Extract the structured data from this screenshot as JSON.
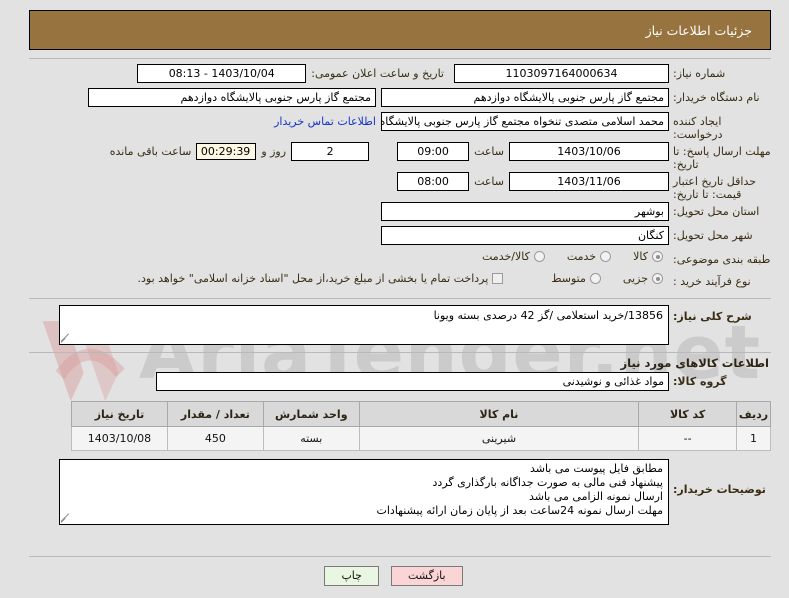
{
  "header": {
    "title": "جزئیات اطلاعات نیاز"
  },
  "form": {
    "need_number_label": "شماره نیاز:",
    "need_number_value": "1103097164000634",
    "announce_datetime_label": "تاریخ و ساعت اعلان عمومی:",
    "announce_datetime_value": "1403/10/04 - 08:13",
    "buyer_org_label": "نام دستگاه خریدار:",
    "buyer_org_value": "مجتمع گاز پارس جنوبی  پالایشگاه دوازدهم",
    "buyer_org_value2": "مجتمع گاز پارس جنوبی  پالایشگاه دوازدهم",
    "creator_label": "ایجاد کننده درخواست:",
    "creator_value": "محمد اسلامی متصدی تنخواه مجتمع گاز پارس جنوبی  پالایشگاه دوازدهم",
    "contact_link": "اطلاعات تماس خریدار",
    "deadline_label": "مهلت ارسال پاسخ: تا تاریخ:",
    "deadline_date": "1403/10/06",
    "deadline_hour_label": "ساعت",
    "deadline_time": "09:00",
    "days_value": "2",
    "days_label": "روز و",
    "countdown_value": "00:29:39",
    "countdown_label": "ساعت باقی مانده",
    "price_validity_label": "حداقل تاریخ اعتبار قیمت: تا تاریخ:",
    "price_validity_date": "1403/11/06",
    "price_validity_hour_label": "ساعت",
    "price_validity_time": "08:00",
    "province_label": "استان محل تحویل:",
    "province_value": "بوشهر",
    "city_label": "شهر محل تحویل:",
    "city_value": "کنگان",
    "category_label": "طبقه بندی موضوعی:",
    "category_options": [
      "کالا",
      "خدمت",
      "کالا/خدمت"
    ],
    "category_selected_index": 0,
    "process_label": "نوع فرآیند خرید :",
    "process_options": [
      "جزیی",
      "متوسط"
    ],
    "process_selected_index": 0,
    "treasury_checkbox_label": "پرداخت تمام یا بخشی از مبلغ خرید،از محل \"اسناد خزانه اسلامی\" خواهد بود.",
    "treasury_checked": false
  },
  "summary": {
    "label": "شرح کلی نیاز:",
    "value": "13856/خرید استعلامی /گز 42 درصدی بسته ویونا"
  },
  "goods_section": {
    "title": "اطلاعات کالاهای مورد نیاز",
    "group_label": "گروه کالا:",
    "group_value": "مواد غذائی و نوشیدنی",
    "columns": [
      "ردیف",
      "کد کالا",
      "نام کالا",
      "واحد شمارش",
      "تعداد / مقدار",
      "تاریخ نیاز"
    ],
    "rows": [
      {
        "row": "1",
        "code": "--",
        "name": "شیرینی",
        "unit": "بسته",
        "quantity": "450",
        "need_date": "1403/10/08"
      }
    ]
  },
  "buyer_notes": {
    "label": "توضیحات خریدار:",
    "lines": [
      "مطابق فایل پیوست می باشد",
      "پیشنهاد فنی مالی به صورت جداگانه بارگذاری گردد",
      "ارسال نمونه الزامی می باشد",
      "مهلت ارسال نمونه 24ساعت بعد از پایان زمان ارائه پیشنهادات"
    ]
  },
  "footer": {
    "print_label": "چاپ",
    "back_label": "بازگشت"
  },
  "watermark": {
    "text": "AriaTender.net"
  },
  "colors": {
    "header_bar": "#97733f",
    "page_background": "#e2e2e2",
    "link": "#1533c8",
    "countdown_bg": "#fdf7e3",
    "back_button_bg": "#fbd5d5",
    "print_button_bg": "#e9f7e2",
    "table_header_bg": "#d9d9d9"
  }
}
